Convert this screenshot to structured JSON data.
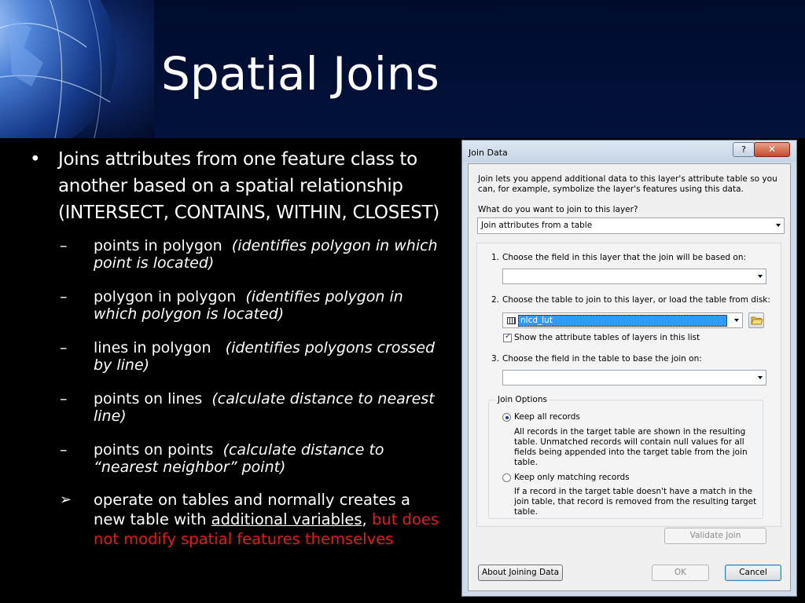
{
  "slide": {
    "title": "Spatial Joins",
    "bullet_main": "Joins attributes from one feature class to another based on a spatial relationship (INTERSECT, CONTAINS, WITHIN, CLOSEST)",
    "sub_items": [
      {
        "bold": "points in polygon",
        "note": "(identifies polygon in which point is located)"
      },
      {
        "bold": "polygon in polygon",
        "note": "(identifies polygon in which polygon is located)"
      },
      {
        "bold": "lines in polygon",
        "note": "(identifies polygons crossed by line)"
      },
      {
        "bold": "points on lines",
        "note": "(calculate distance to nearest line)"
      },
      {
        "bold": "points on points",
        "note": "(calculate distance to “nearest neighbor” point)"
      }
    ],
    "arrow_item": {
      "text_a": "operate on tables and normally creates a new table with ",
      "underlined": "additional variables",
      "text_b": ", ",
      "red": "but does not modify spatial features themselves"
    },
    "colors": {
      "accent_red": "#e21b1b",
      "header_bg": "#000b2c"
    }
  },
  "dialog": {
    "title": "Join Data",
    "help_label": "?",
    "close_label": "✕",
    "intro": "Join lets you append additional data to this layer's attribute table so you can, for example, symbolize the layer's features using this data.",
    "what_label": "What do you want to join to this layer?",
    "join_type_value": "Join attributes from a table",
    "step1_num": "1.",
    "step1_label": "Choose the field in this layer that the join will be based on:",
    "step1_value": "",
    "step2_num": "2.",
    "step2_label": "Choose the table to join to this layer, or load the table from disk:",
    "step2_value": "nlcd_lut",
    "show_layers_label": "Show the attribute tables of layers in this list",
    "show_layers_checked": true,
    "step3_num": "3.",
    "step3_label": "Choose the field in the table to base the join on:",
    "step3_value": "",
    "join_options_label": "Join Options",
    "keep_all_label": "Keep all records",
    "keep_all_desc": "All records in the target table are shown in the resulting table. Unmatched records will contain null values for all fields being appended into the target table from the join table.",
    "keep_matching_label": "Keep only matching records",
    "keep_matching_desc": "If a record in the target table doesn't have a match in the join table, that record is removed from the resulting target table.",
    "selected_option": "keep_all",
    "validate_label": "Validate Join",
    "about_label": "About Joining Data",
    "ok_label": "OK",
    "cancel_label": "Cancel"
  }
}
